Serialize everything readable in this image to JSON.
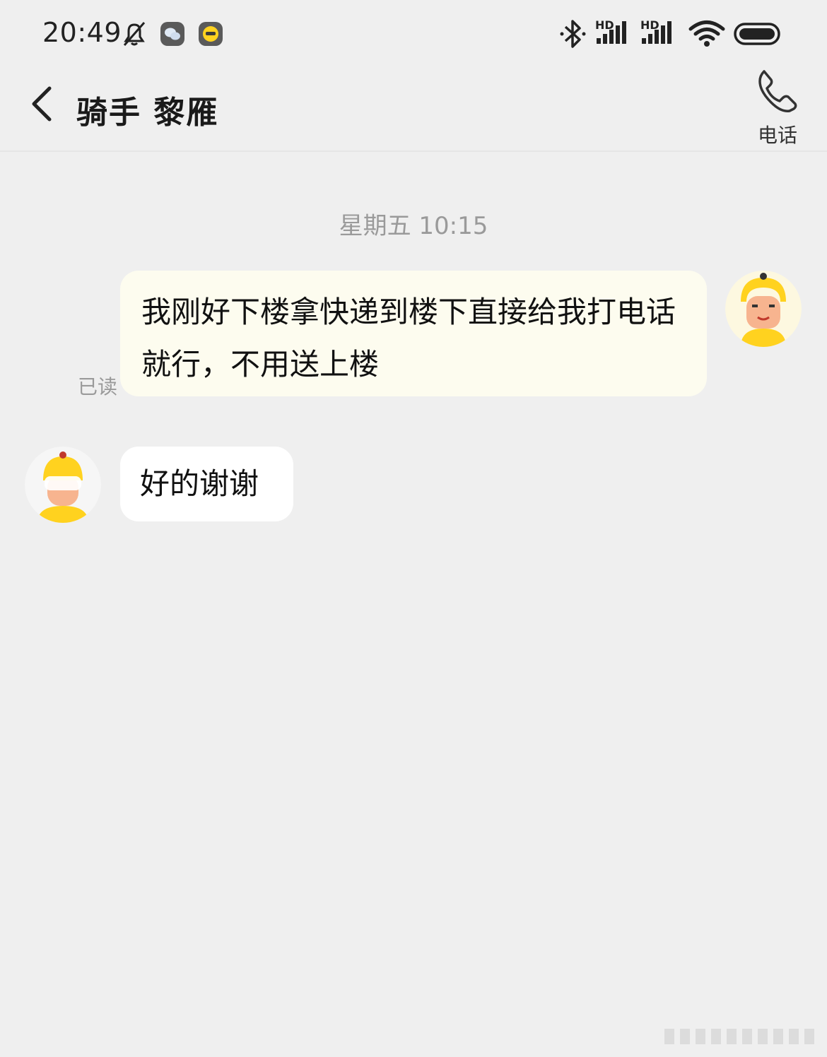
{
  "status_bar": {
    "time": "20:49",
    "icons": [
      "mute-bell-icon",
      "chat-app-icon",
      "yellow-app-icon",
      "bluetooth-icon",
      "hd-signal-icon",
      "hd-signal-icon",
      "wifi-icon",
      "battery-icon"
    ],
    "hd_label_1": "HD",
    "hd_label_2": "HD"
  },
  "header": {
    "title": "骑手 黎雁",
    "call_label": "电话",
    "icons": {
      "back": "chevron-left-icon",
      "call": "phone-icon"
    }
  },
  "chat": {
    "timestamp": "星期五 10:15",
    "messages": [
      {
        "side": "outgoing",
        "text": "我刚好下楼拿快递到楼下直接给我打电话就行，不用送上楼",
        "status": "已读"
      },
      {
        "side": "incoming",
        "text": "好的谢谢"
      }
    ]
  },
  "colors": {
    "background": "#efefef",
    "outgoing_bubble": "#fdfcef",
    "incoming_bubble": "#ffffff",
    "avatar_yellow": "#ffd21f"
  }
}
